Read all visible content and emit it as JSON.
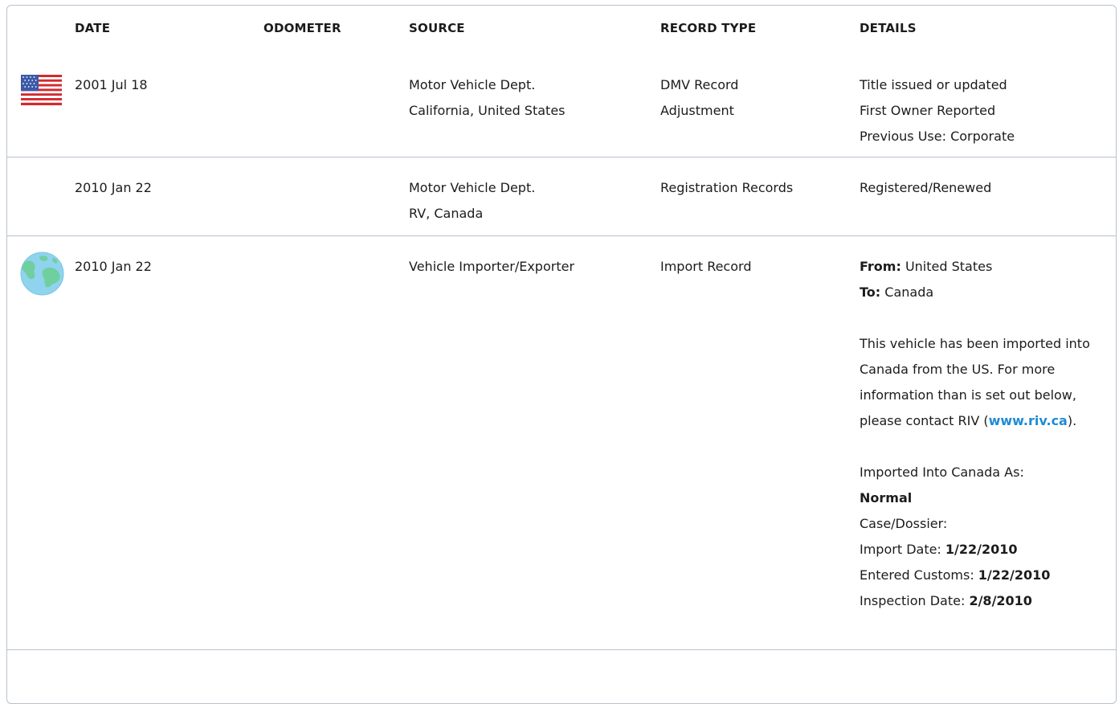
{
  "headers": {
    "date": "DATE",
    "odometer": "ODOMETER",
    "source": "SOURCE",
    "record_type": "RECORD TYPE",
    "details": "DETAILS"
  },
  "rows": [
    {
      "icon": "us-flag-icon",
      "date": "2001 Jul 18",
      "odometer": "",
      "source": [
        "Motor Vehicle Dept.",
        "California, United States"
      ],
      "record_type": [
        "DMV Record",
        "Adjustment"
      ],
      "details": [
        "Title issued or updated",
        "First Owner Reported",
        "Previous Use: Corporate"
      ]
    },
    {
      "icon": "",
      "date": "2010 Jan 22",
      "odometer": "",
      "source": [
        "Motor Vehicle Dept.",
        "RV, Canada"
      ],
      "record_type": [
        "Registration Records"
      ],
      "details": [
        "Registered/Renewed"
      ]
    },
    {
      "icon": "globe-icon",
      "date": "2010 Jan 22",
      "odometer": "",
      "source": [
        "Vehicle Importer/Exporter"
      ],
      "record_type": [
        "Import Record"
      ],
      "details": {
        "from_label": "From:",
        "from_value": "United States",
        "to_label": "To:",
        "to_value": "Canada",
        "paragraph_before_link": "This vehicle has been imported into Canada from the US. For more information than is set out below, please contact RIV (",
        "link_text": "www.riv.ca",
        "paragraph_after_link": ").",
        "imported_as_label": "Imported Into Canada As:",
        "imported_as_value": "Normal",
        "case_label": "Case/Dossier:",
        "import_date_label": "Import Date:",
        "import_date_value": "1/22/2010",
        "entered_customs_label": "Entered Customs:",
        "entered_customs_value": "1/22/2010",
        "inspection_date_label": "Inspection Date:",
        "inspection_date_value": "2/8/2010"
      }
    }
  ],
  "colors": {
    "border": "#b9c2cc",
    "link": "#1e8bd6",
    "text": "#1c1c1c"
  }
}
